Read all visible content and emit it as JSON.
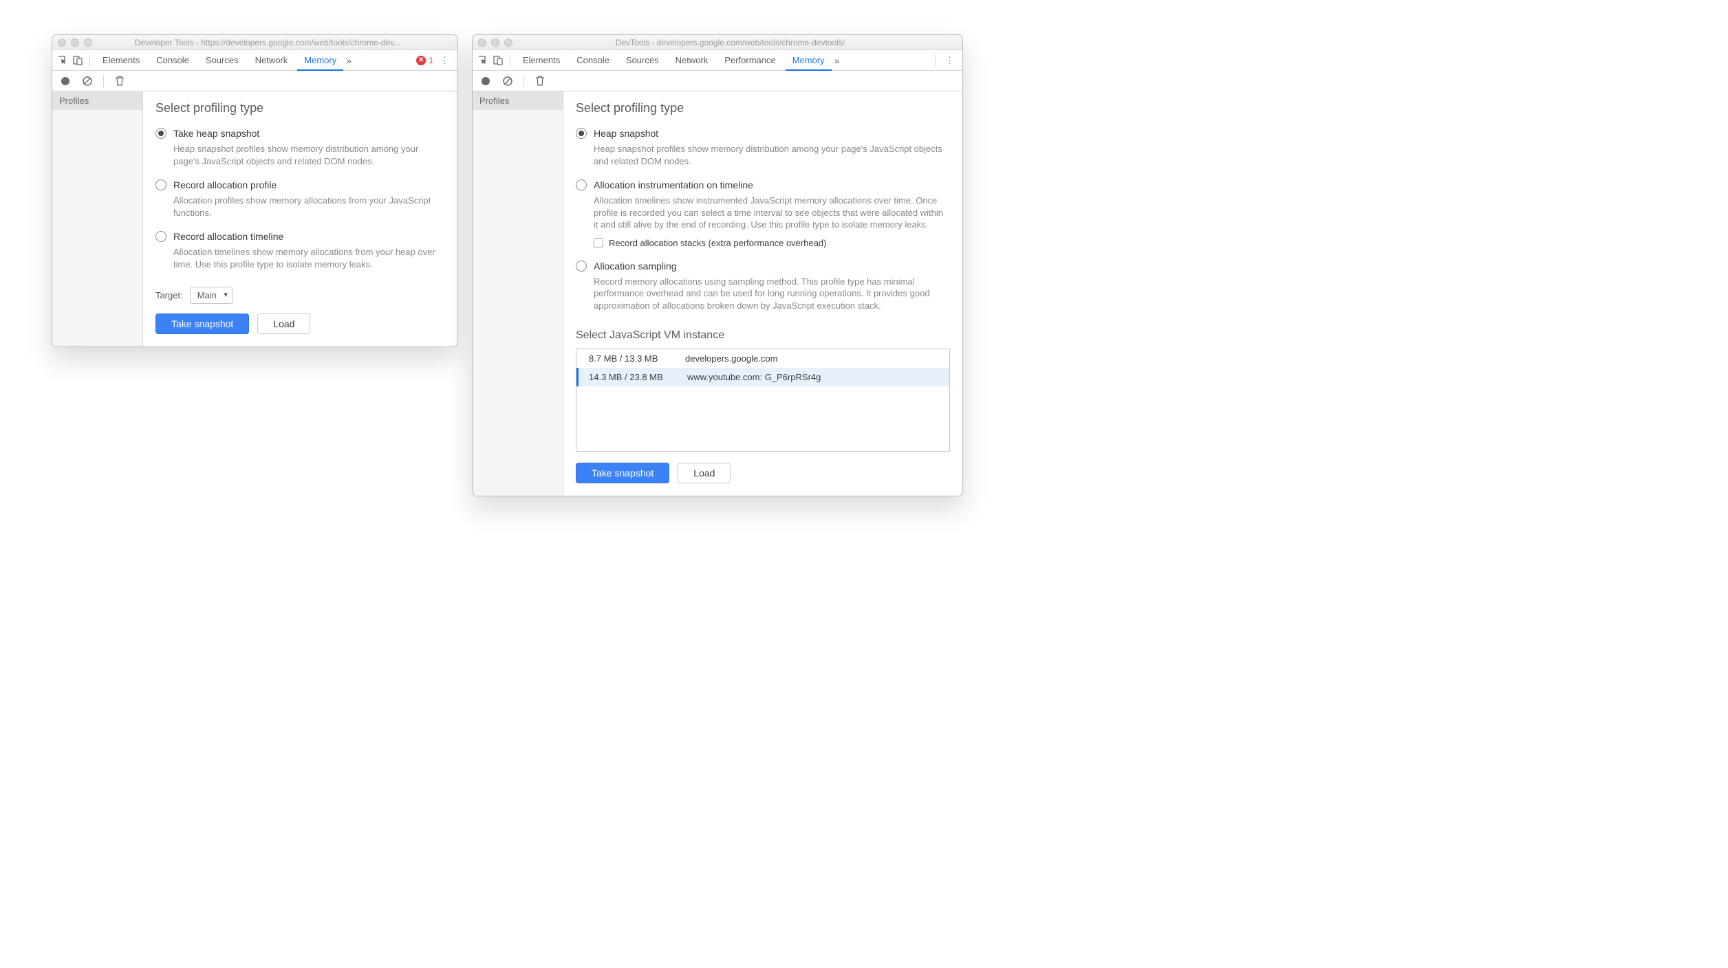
{
  "left": {
    "title": "Developer Tools - https://developers.google.com/web/tools/chrome-dev...",
    "tabs": [
      "Elements",
      "Console",
      "Sources",
      "Network",
      "Memory"
    ],
    "active_tab": "Memory",
    "error_count": "1",
    "sidebar_header": "Profiles",
    "section_title": "Select profiling type",
    "options": [
      {
        "title": "Take heap snapshot",
        "desc": "Heap snapshot profiles show memory distribution among your page's JavaScript objects and related DOM nodes.",
        "checked": true
      },
      {
        "title": "Record allocation profile",
        "desc": "Allocation profiles show memory allocations from your JavaScript functions.",
        "checked": false
      },
      {
        "title": "Record allocation timeline",
        "desc": "Allocation timelines show memory allocations from your heap over time. Use this profile type to isolate memory leaks.",
        "checked": false
      }
    ],
    "target_label": "Target:",
    "target_value": "Main",
    "take_label": "Take snapshot",
    "load_label": "Load"
  },
  "right": {
    "title": "DevTools - developers.google.com/web/tools/chrome-devtools/",
    "tabs": [
      "Elements",
      "Console",
      "Sources",
      "Network",
      "Performance",
      "Memory"
    ],
    "active_tab": "Memory",
    "sidebar_header": "Profiles",
    "section_title": "Select profiling type",
    "options": [
      {
        "title": "Heap snapshot",
        "desc": "Heap snapshot profiles show memory distribution among your page's JavaScript objects and related DOM nodes.",
        "checked": true
      },
      {
        "title": "Allocation instrumentation on timeline",
        "desc": "Allocation timelines show instrumented JavaScript memory allocations over time. Once profile is recorded you can select a time interval to see objects that were allocated within it and still alive by the end of recording. Use this profile type to isolate memory leaks.",
        "checked": false,
        "sub_checkbox": "Record allocation stacks (extra performance overhead)"
      },
      {
        "title": "Allocation sampling",
        "desc": "Record memory allocations using sampling method. This profile type has minimal performance overhead and can be used for long running operations. It provides good approximation of allocations broken down by JavaScript execution stack.",
        "checked": false
      }
    ],
    "vm_title": "Select JavaScript VM instance",
    "vm_rows": [
      {
        "mem": "8.7 MB / 13.3 MB",
        "name": "developers.google.com",
        "selected": false
      },
      {
        "mem": "14.3 MB / 23.8 MB",
        "name": "www.youtube.com: G_P6rpRSr4g",
        "selected": true
      }
    ],
    "take_label": "Take snapshot",
    "load_label": "Load"
  }
}
